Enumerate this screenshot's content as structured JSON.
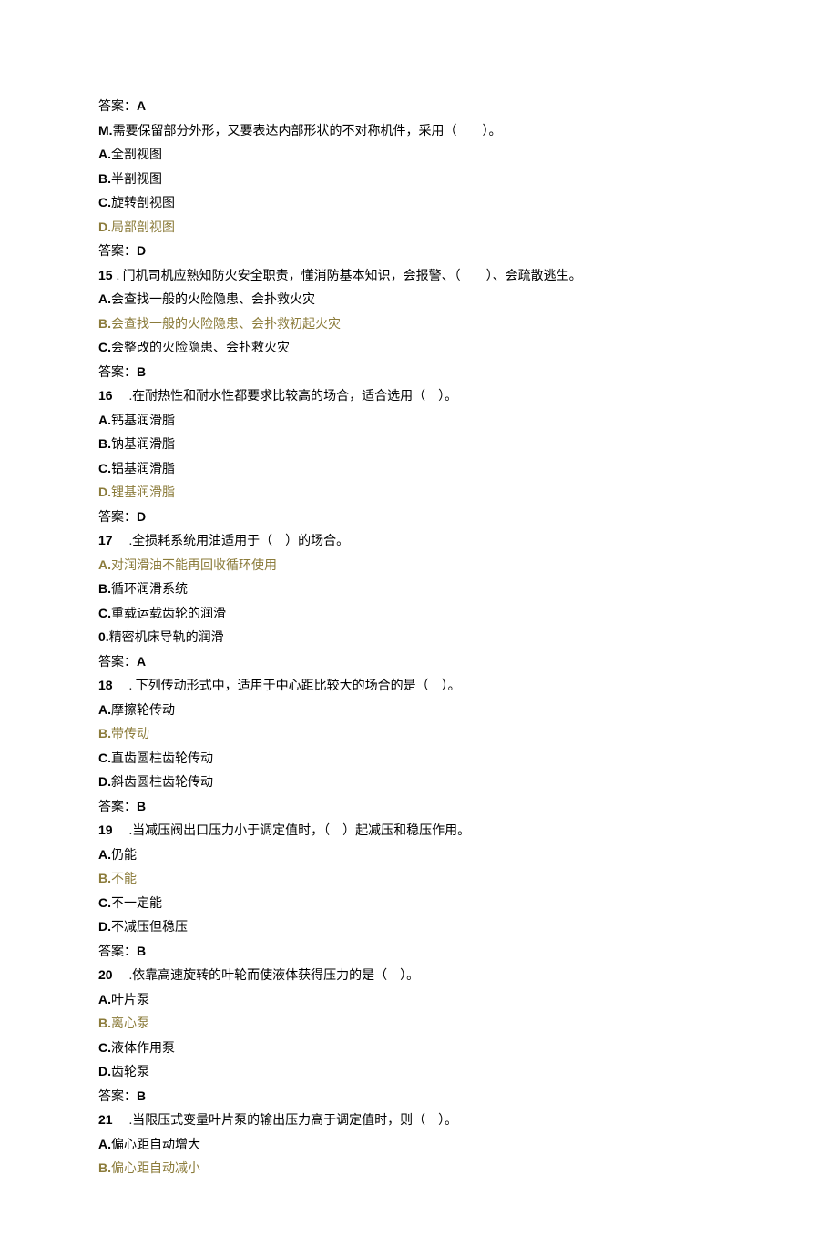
{
  "q13": {
    "ans_label": "答案：",
    "ans": "A"
  },
  "qM": {
    "num": "M.",
    "stem": "需要保留部分外形，又要表达内部形状的不对称机件，采用（　　）。",
    "a": {
      "k": "A.",
      "t": "全剖视图"
    },
    "b": {
      "k": "B.",
      "t": "半剖视图"
    },
    "c": {
      "k": "C.",
      "t": "旋转剖视图"
    },
    "d": {
      "k": "D.",
      "t": "局部剖视图"
    },
    "ans_label": "答案：",
    "ans": "D"
  },
  "q15": {
    "num": "15",
    "stem": ". 门机司机应熟知防火安全职责，懂消防基本知识，会报警、（　　）、会疏散逃生。",
    "a": {
      "k": "A.",
      "t": "会查找一般的火险隐患、会扑救火灾"
    },
    "b": {
      "k": "B.",
      "t": "会查找一般的火险隐患、会扑救初起火灾"
    },
    "c": {
      "k": "C.",
      "t": "会整改的火险隐患、会扑救火灾"
    },
    "ans_label": "答案：",
    "ans": "B"
  },
  "q16": {
    "num": "16",
    "stem": "　.在耐热性和耐水性都要求比较高的场合，适合选用（　）。",
    "a": {
      "k": "A.",
      "t": "钙基润滑脂"
    },
    "b": {
      "k": "B.",
      "t": "钠基润滑脂"
    },
    "c": {
      "k": "C.",
      "t": "铝基润滑脂"
    },
    "d": {
      "k": "D.",
      "t": "锂基润滑脂"
    },
    "ans_label": "答案：",
    "ans": "D"
  },
  "q17": {
    "num": "17",
    "stem": "　.全损耗系统用油适用于（　）的场合。",
    "a": {
      "k": "A.",
      "t": "对润滑油不能再回收循环使用"
    },
    "b": {
      "k": "B.",
      "t": "循环润滑系统"
    },
    "c": {
      "k": "C.",
      "t": "重载运载齿轮的润滑"
    },
    "o": {
      "k": "0.",
      "t": "精密机床导轨的润滑"
    },
    "ans_label": "答案：",
    "ans": "A"
  },
  "q18": {
    "num": "18",
    "stem": "　. 下列传动形式中，适用于中心距比较大的场合的是（　）。",
    "a": {
      "k": "A.",
      "t": "摩擦轮传动"
    },
    "b": {
      "k": "B.",
      "t": "带传动"
    },
    "c": {
      "k": "C.",
      "t": "直齿圆柱齿轮传动"
    },
    "d": {
      "k": "D.",
      "t": "斜齿圆柱齿轮传动"
    },
    "ans_label": "答案：",
    "ans": "B"
  },
  "q19": {
    "num": "19",
    "stem": "　.当减压阀出口压力小于调定值时，（　）起减压和稳压作用。",
    "a": {
      "k": "A.",
      "t": "仍能"
    },
    "b": {
      "k": "B.",
      "t": "不能"
    },
    "c": {
      "k": "C.",
      "t": "不一定能"
    },
    "d": {
      "k": "D.",
      "t": "不减压但稳压"
    },
    "ans_label": "答案：",
    "ans": "B"
  },
  "q20": {
    "num": "20",
    "stem": "　.依靠高速旋转的叶轮而使液体获得压力的是（　）。",
    "a": {
      "k": "A.",
      "t": "叶片泵"
    },
    "b": {
      "k": "B.",
      "t": "离心泵"
    },
    "c": {
      "k": "C.",
      "t": "液体作用泵"
    },
    "d": {
      "k": "D.",
      "t": "齿轮泵"
    },
    "ans_label": "答案：",
    "ans": "B"
  },
  "q21": {
    "num": "21",
    "stem": "　.当限压式变量叶片泵的输出压力高于调定值时，则（　）。",
    "a": {
      "k": "A.",
      "t": "偏心距自动增大"
    },
    "b": {
      "k": "B.",
      "t": "偏心距自动减小"
    }
  }
}
